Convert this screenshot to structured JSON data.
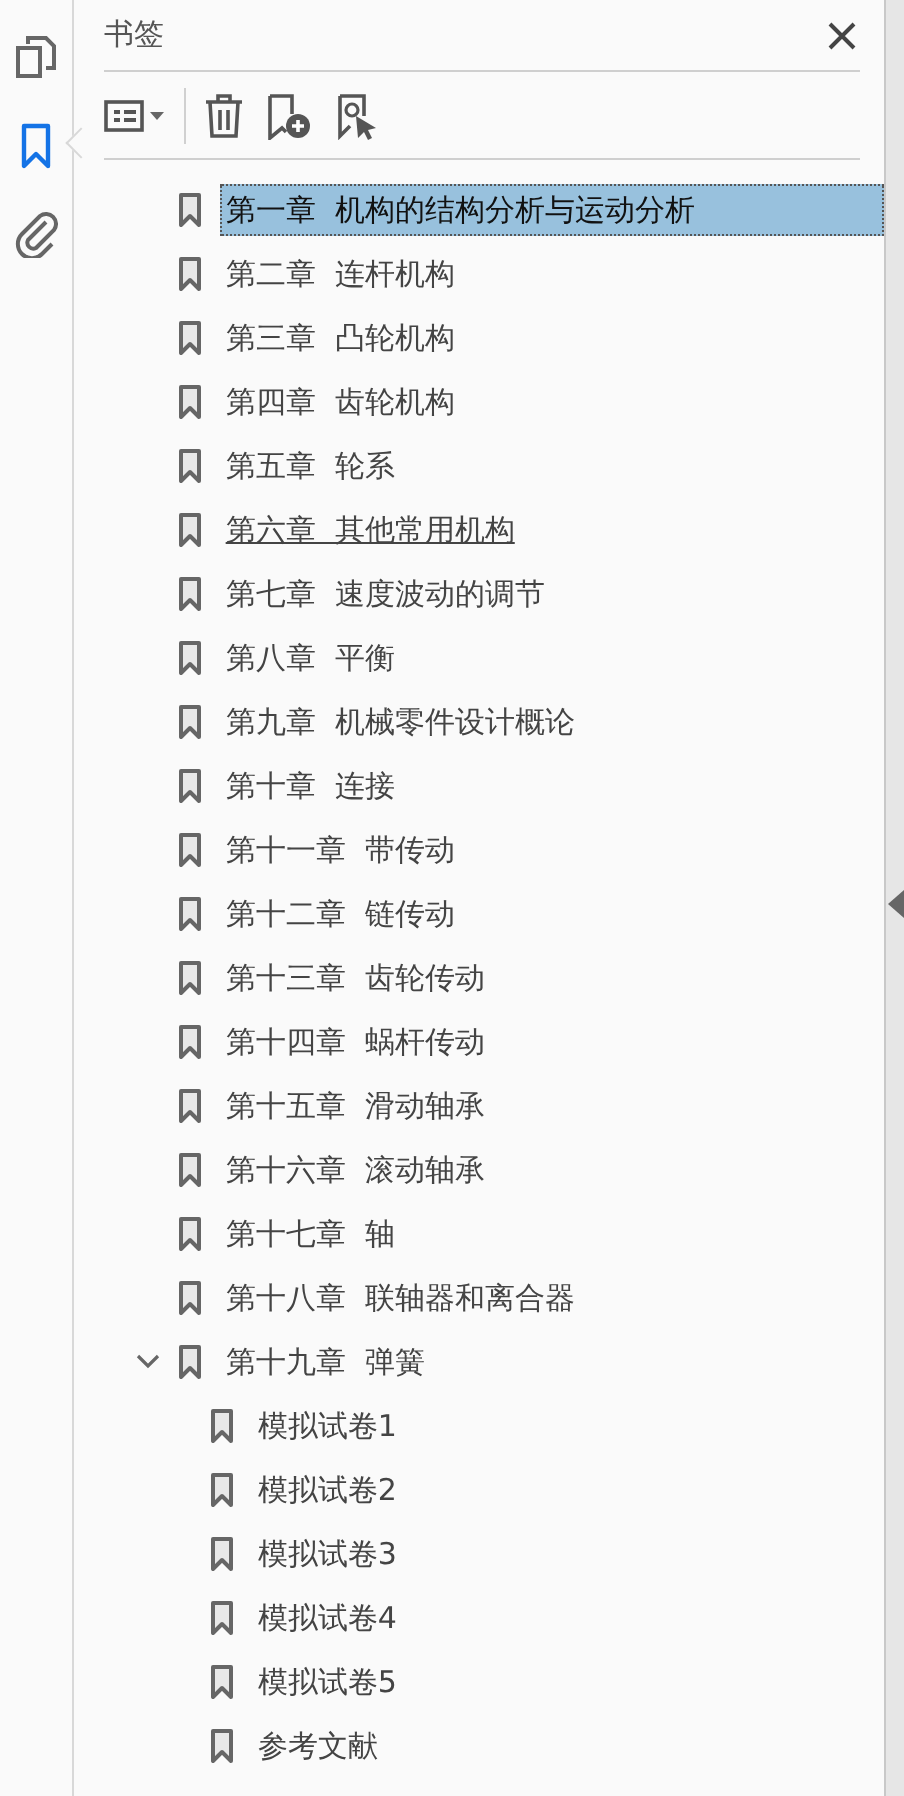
{
  "rail": [
    {
      "kind": "pages",
      "selected": false
    },
    {
      "kind": "bookmarks",
      "selected": true
    },
    {
      "kind": "attachments",
      "selected": false
    }
  ],
  "panel": {
    "title": "书签"
  },
  "bookmarks": [
    {
      "label": "第一章  机构的结构分析与运动分析",
      "selected": true,
      "hovered": false
    },
    {
      "label": "第二章  连杆机构",
      "selected": false,
      "hovered": false
    },
    {
      "label": "第三章  凸轮机构",
      "selected": false,
      "hovered": false
    },
    {
      "label": "第四章  齿轮机构",
      "selected": false,
      "hovered": false
    },
    {
      "label": "第五章  轮系",
      "selected": false,
      "hovered": false
    },
    {
      "label": "第六章  其他常用机构",
      "selected": false,
      "hovered": true
    },
    {
      "label": "第七章  速度波动的调节",
      "selected": false,
      "hovered": false
    },
    {
      "label": "第八章  平衡",
      "selected": false,
      "hovered": false
    },
    {
      "label": "第九章  机械零件设计概论",
      "selected": false,
      "hovered": false
    },
    {
      "label": "第十章  连接",
      "selected": false,
      "hovered": false
    },
    {
      "label": "第十一章  带传动",
      "selected": false,
      "hovered": false
    },
    {
      "label": "第十二章  链传动",
      "selected": false,
      "hovered": false
    },
    {
      "label": "第十三章  齿轮传动",
      "selected": false,
      "hovered": false
    },
    {
      "label": "第十四章  蜗杆传动",
      "selected": false,
      "hovered": false
    },
    {
      "label": "第十五章  滑动轴承",
      "selected": false,
      "hovered": false
    },
    {
      "label": "第十六章  滚动轴承",
      "selected": false,
      "hovered": false
    },
    {
      "label": "第十七章  轴",
      "selected": false,
      "hovered": false
    },
    {
      "label": "第十八章  联轴器和离合器",
      "selected": false,
      "hovered": false
    },
    {
      "label": "第十九章  弹簧",
      "selected": false,
      "hovered": false,
      "expanded": true,
      "children": [
        {
          "label": "模拟试卷1",
          "selected": false,
          "hovered": false
        },
        {
          "label": "模拟试卷2",
          "selected": false,
          "hovered": false
        },
        {
          "label": "模拟试卷3",
          "selected": false,
          "hovered": false
        },
        {
          "label": "模拟试卷4",
          "selected": false,
          "hovered": false
        },
        {
          "label": "模拟试卷5",
          "selected": false,
          "hovered": false
        },
        {
          "label": "参考文献",
          "selected": false,
          "hovered": false
        }
      ]
    }
  ]
}
